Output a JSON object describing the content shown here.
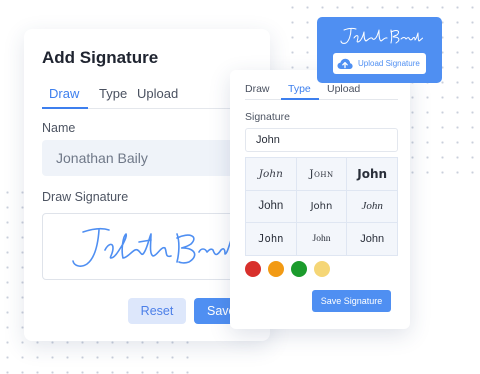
{
  "main_card": {
    "title": "Add Signature",
    "tabs": [
      {
        "label": "Draw",
        "active": true
      },
      {
        "label": "Type",
        "active": false
      },
      {
        "label": "Upload",
        "active": false
      }
    ],
    "name_label": "Name",
    "name_value": "Jonathan Baily",
    "draw_label": "Draw Signature",
    "reset_label": "Reset",
    "save_label": "Save"
  },
  "upload_card": {
    "upload_label": "Upload Signature",
    "icon": "cloud-upload-icon"
  },
  "type_card": {
    "tabs": [
      {
        "label": "Draw",
        "active": false
      },
      {
        "label": "Type",
        "active": true
      },
      {
        "label": "Upload",
        "active": false
      }
    ],
    "signature_label": "Signature",
    "signature_value": "John",
    "font_samples": [
      "John",
      "John",
      "John",
      "John",
      "John",
      "John",
      "John",
      "John",
      "John"
    ],
    "colors": [
      "#d8302c",
      "#f29a14",
      "#1b9b2c",
      "#f5d676"
    ],
    "save_label": "Save Signature"
  },
  "theme": {
    "accent": "#4f8ff2",
    "signature_ink": "#4f8ff2"
  }
}
